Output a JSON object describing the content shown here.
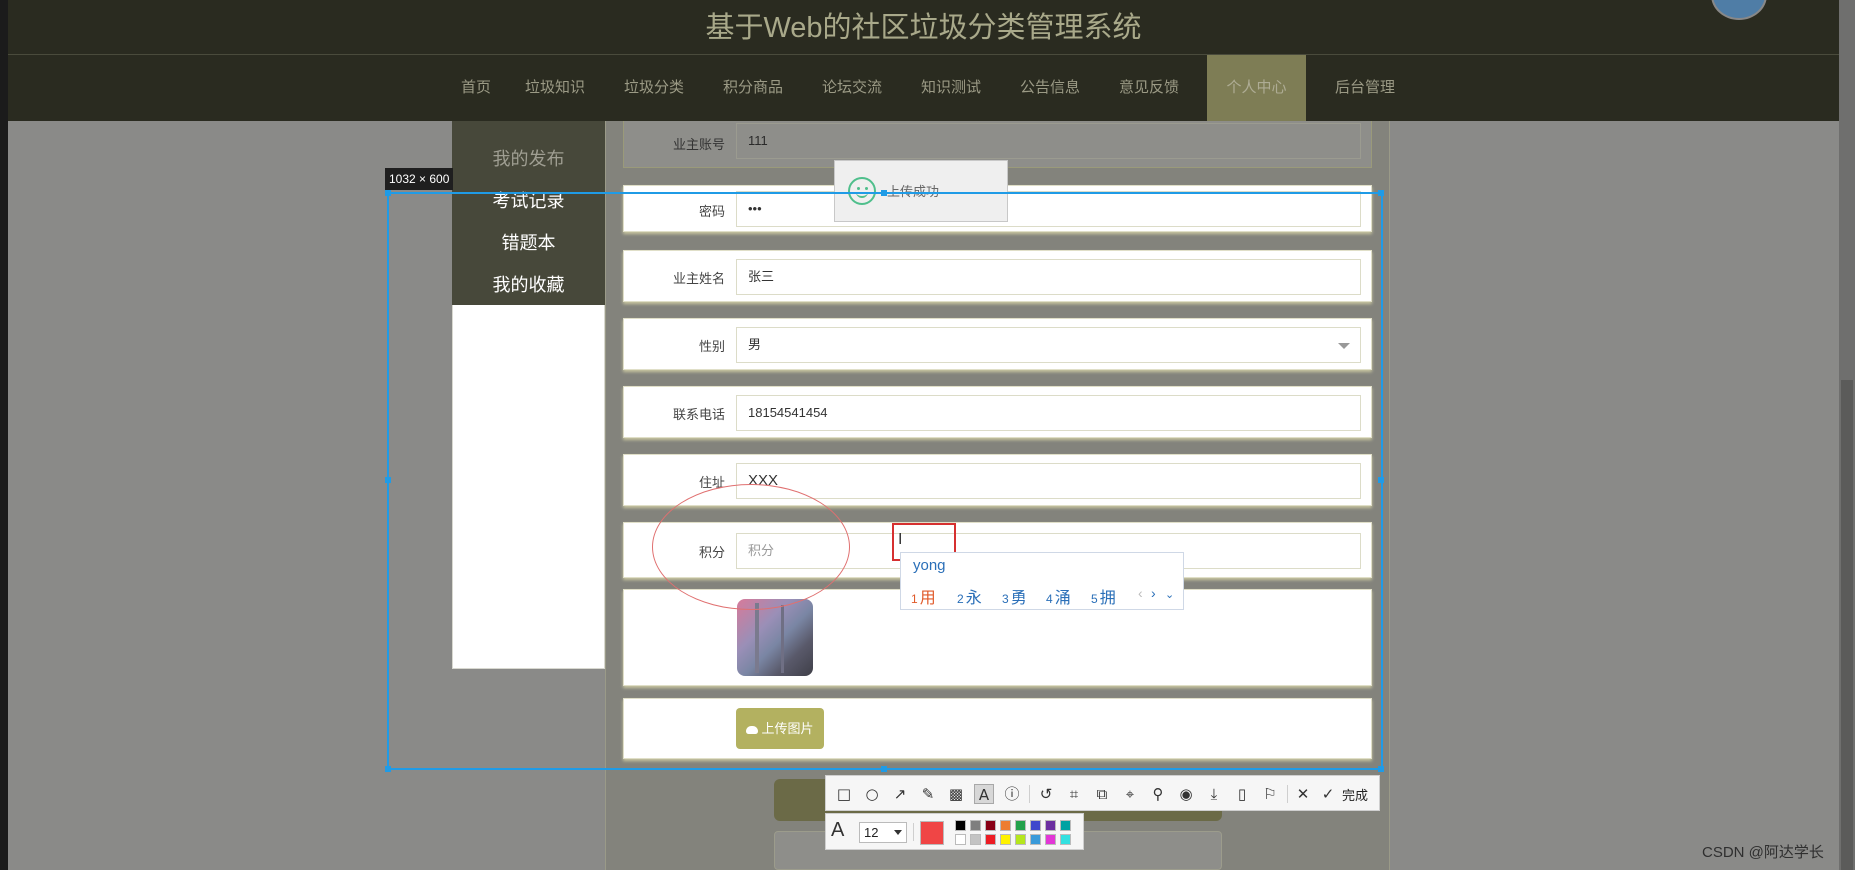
{
  "header": {
    "title": "基于Web的社区垃圾分类管理系统"
  },
  "nav": {
    "items": [
      {
        "label": "首页",
        "active": false
      },
      {
        "label": "垃圾知识",
        "active": false
      },
      {
        "label": "垃圾分类",
        "active": false
      },
      {
        "label": "积分商品",
        "active": false
      },
      {
        "label": "论坛交流",
        "active": false
      },
      {
        "label": "知识测试",
        "active": false
      },
      {
        "label": "公告信息",
        "active": false
      },
      {
        "label": "意见反馈",
        "active": false
      },
      {
        "label": "个人中心",
        "active": true
      },
      {
        "label": "后台管理",
        "active": false
      }
    ]
  },
  "sidebar": {
    "items": [
      {
        "label": "我的发布"
      },
      {
        "label": "考试记录"
      },
      {
        "label": "错题本"
      },
      {
        "label": "我的收藏"
      }
    ]
  },
  "form": {
    "account": {
      "label": "业主账号",
      "value": "111"
    },
    "password": {
      "label": "密码",
      "value": "•••"
    },
    "name": {
      "label": "业主姓名",
      "value": "张三"
    },
    "gender": {
      "label": "性别",
      "value": "男"
    },
    "phone": {
      "label": "联系电话",
      "value": "18154541454"
    },
    "address": {
      "label": "住址",
      "value": "XXX"
    },
    "points": {
      "label": "积分",
      "placeholder": "积分"
    },
    "upload_label": "上传图片"
  },
  "toast": {
    "message": "上传成功"
  },
  "screenshot_tool": {
    "size_label": "1032 × 600",
    "annotation_color": "#d63030",
    "selection_color": "#1f9be6",
    "done_label": "完成",
    "font_size": "12",
    "active_color": "#f04545",
    "palette": [
      "#000000",
      "#7f7f7f",
      "#880015",
      "#ed7d31",
      "#22a14b",
      "#3f48cc",
      "#6b2fa0",
      "#00a2a2",
      "#ffffff",
      "#c3c3c3",
      "#ed1c24",
      "#fff200",
      "#b5e61d",
      "#3a9ad9",
      "#e236d6",
      "#33e0e0"
    ],
    "tools": [
      "rectangle-icon",
      "ellipse-icon",
      "arrow-icon",
      "pencil-icon",
      "mosaic-icon",
      "text-icon",
      "number-icon",
      "undo-icon",
      "ocr-icon",
      "translate-icon",
      "screen-record-icon",
      "pin-icon",
      "record-icon",
      "download-icon",
      "save-icon",
      "bookmark-icon",
      "close-icon",
      "check-icon"
    ]
  },
  "ime": {
    "input": "yong",
    "candidates": [
      {
        "num": "1",
        "text": "用"
      },
      {
        "num": "2",
        "text": "永"
      },
      {
        "num": "3",
        "text": "勇"
      },
      {
        "num": "4",
        "text": "涌"
      },
      {
        "num": "5",
        "text": "拥"
      }
    ]
  },
  "watermark": "CSDN @阿达学长"
}
